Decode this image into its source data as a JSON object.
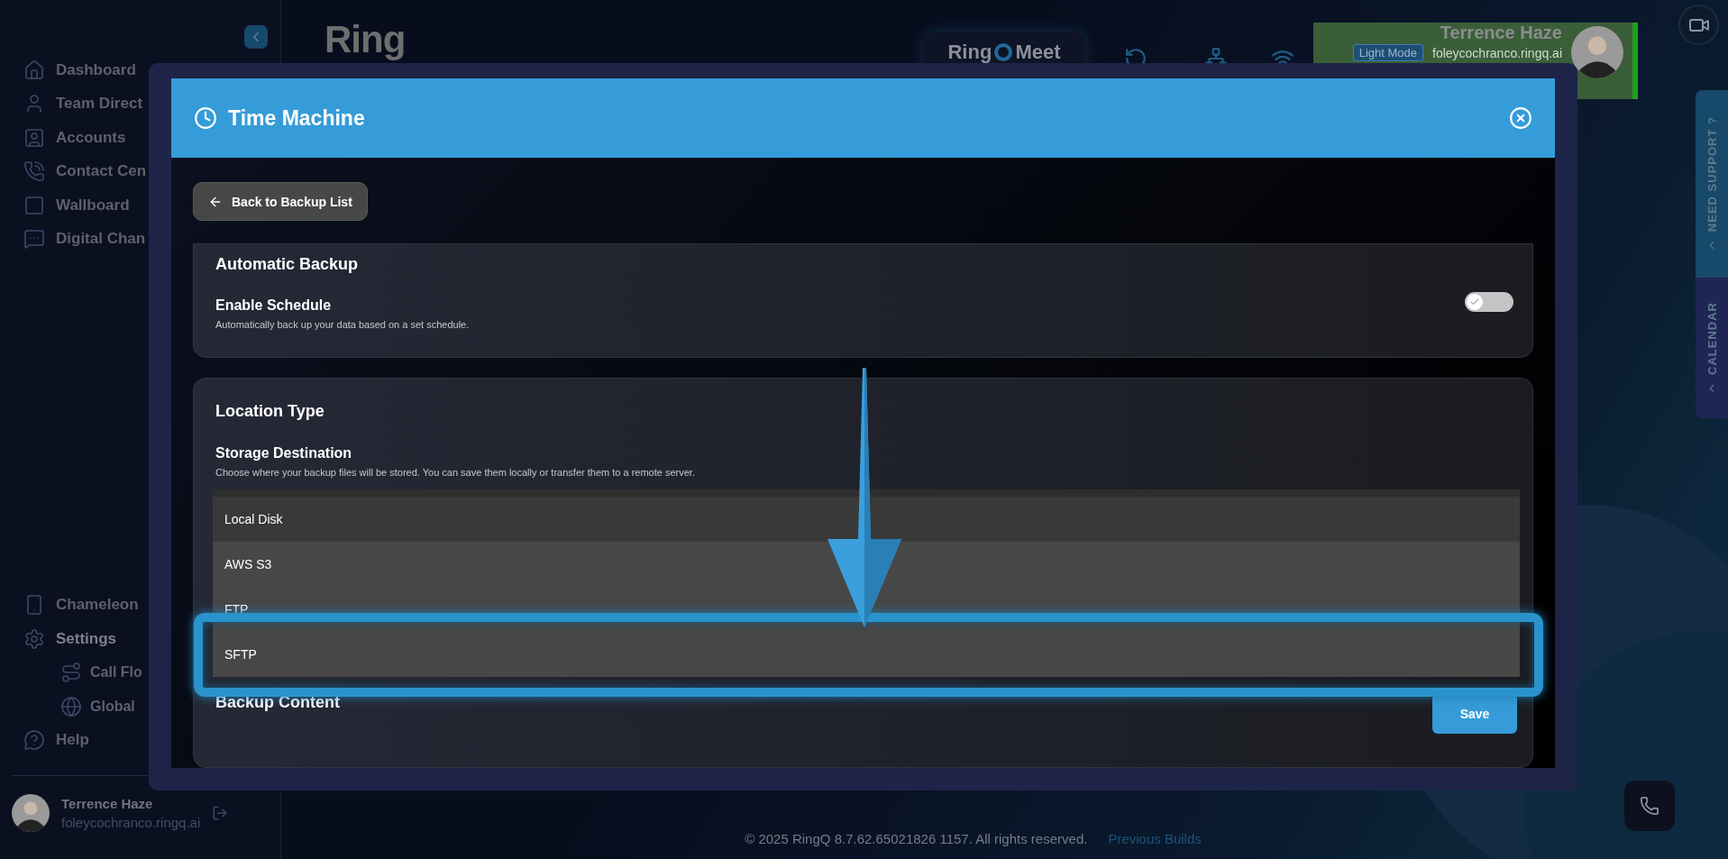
{
  "sidebar": {
    "nav_top": [
      {
        "label": "Dashboard",
        "selected": false
      },
      {
        "label": "Team Direct",
        "selected": false
      },
      {
        "label": "Accounts",
        "selected": false
      },
      {
        "label": "Contact Cen",
        "selected": false
      },
      {
        "label": "Wallboard",
        "selected": false
      },
      {
        "label": "Digital Chan",
        "selected": false
      }
    ],
    "nav_bottom": [
      {
        "label": "Chameleon",
        "selected": false
      },
      {
        "label": "Settings",
        "selected": true,
        "children": [
          {
            "label": "Call Flo",
            "selected": false
          },
          {
            "label": "Global",
            "selected": false
          }
        ]
      },
      {
        "label": "Help",
        "selected": false
      }
    ],
    "user": {
      "name": "Terrence Haze",
      "email": "foleycochranco.ringq.ai"
    }
  },
  "header": {
    "logo_text": "Ring",
    "meet_button": {
      "left": "Ring",
      "right": "Meet"
    },
    "user_card": {
      "name": "Terrence Haze",
      "mode_badge": "Light Mode",
      "email": "foleycochranco.ringq.ai"
    }
  },
  "side_tabs": [
    "NEED SUPPORT ?",
    "CALENDAR"
  ],
  "footer": {
    "copyright": "© 2025 RingQ 8.7.62.65021826 1157. All rights reserved.",
    "link": "Previous Builds"
  },
  "modal": {
    "title": "Time Machine",
    "back_button": "Back to Backup List",
    "automatic_backup": {
      "title": "Automatic Backup",
      "setting": "Enable Schedule",
      "description": "Automatically back up your data based on a set schedule.",
      "on": false
    },
    "location": {
      "title": "Location Type",
      "field_label": "Storage Destination",
      "description": "Choose where your backup files will be stored. You can save them locally or transfer them to a remote server.",
      "options": [
        {
          "label": "Local Disk",
          "selected": true,
          "highlighted": false
        },
        {
          "label": "AWS S3",
          "selected": false,
          "highlighted": false
        },
        {
          "label": "FTP",
          "selected": false,
          "highlighted": false
        },
        {
          "label": "SFTP",
          "selected": false,
          "highlighted": true
        }
      ]
    },
    "next_section": "Backup Content",
    "save_button": "Save"
  }
}
